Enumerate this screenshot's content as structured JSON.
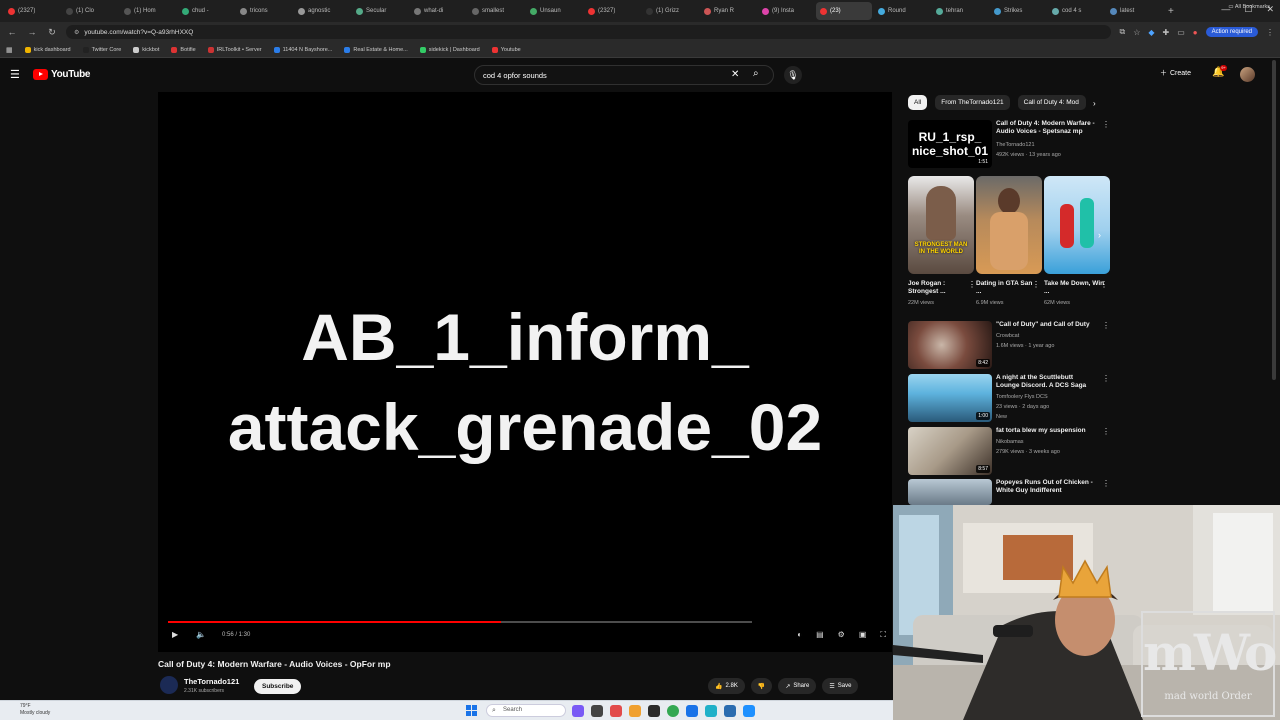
{
  "browser": {
    "tabs": [
      "(2327)",
      "(1) Clo",
      "(1) Hom",
      "chud -",
      "tricons",
      "agnostic",
      "Secular",
      "what-di",
      "smallest",
      "Unsaun",
      "(2327)",
      "(1) Grizz",
      "Ryan R",
      "(9) Insta",
      "(23)",
      "Round",
      "tehran",
      "Strikes",
      "cod 4 s",
      "latest"
    ],
    "active_tab": 14,
    "url": "youtube.com/watch?v=Q-a93rhHXXQ",
    "action_required": "Action required",
    "bookmarks": [
      "kick dashboard",
      "Twitter Core",
      "kickbot",
      "Botifie",
      "IRLToolkit • Server",
      "11404 N Bayshore...",
      "Real Estate & Home...",
      "sidekick | Dashboard",
      "Youtube"
    ],
    "all_bookmarks": "All Bookmarks"
  },
  "youtube": {
    "logo_text": "YouTube",
    "search_value": "cod 4 opfor sounds",
    "create_label": "Create",
    "notif_count": "9+"
  },
  "player": {
    "video_text_line1": "AB_1_inform_",
    "video_text_line2": "attack_grenade_02",
    "time": "0:56 / 1:30",
    "progress": 0.57
  },
  "video": {
    "title": "Call of Duty 4: Modern Warfare - Audio Voices - OpFor mp",
    "channel": "TheTornado121",
    "subscribers": "2.31K subscribers",
    "subscribe_label": "Subscribe",
    "likes": "2.8K",
    "share_label": "Share",
    "save_label": "Save"
  },
  "sidebar": {
    "chips": [
      "All",
      "From TheTornado121",
      "Call of Duty 4: Mod"
    ],
    "recommendations": [
      {
        "thumb_text": "RU_1_rsp_ nice_shot_01",
        "duration": "1:51",
        "title": "Call of Duty 4: Modern Warfare - Audio Voices - Spetsnaz mp",
        "channel": "TheTornado121",
        "meta": "492K views · 13 years ago"
      },
      {
        "duration": "8:42",
        "title": "\"Call of Duty\" and Call of Duty",
        "channel": "Crowbcat",
        "meta": "1.6M views · 1 year ago"
      },
      {
        "duration": "1:00",
        "title": "A night at the Scuttlebutt Lounge Discord. A DCS Saga",
        "channel": "Tomfoolery Flys DCS",
        "meta": "23 views · 2 days ago",
        "badge": "New"
      },
      {
        "duration": "8:57",
        "title": "fat torta blew my suspension",
        "channel": "Nikobamas",
        "meta": "279K views · 3 weeks ago"
      },
      {
        "title": "Popeyes Runs Out of Chicken - White Guy Indifferent",
        "channel": "",
        "meta": ""
      }
    ],
    "shorts": [
      {
        "caption": "Joe Rogan : Strongest ...",
        "views": "22M views",
        "overlay": "STRONGEST MAN IN THE WORLD"
      },
      {
        "caption": "Dating in GTA San ...",
        "views": "6.9M views"
      },
      {
        "caption": "Take Me Down, Win ...",
        "views": "62M views"
      }
    ]
  },
  "webcam": {
    "watermark_big": "mWo",
    "watermark_small": "mad world Order"
  },
  "taskbar": {
    "weather_temp": "79°F",
    "weather_desc": "Mostly cloudy",
    "search_placeholder": "Search"
  }
}
